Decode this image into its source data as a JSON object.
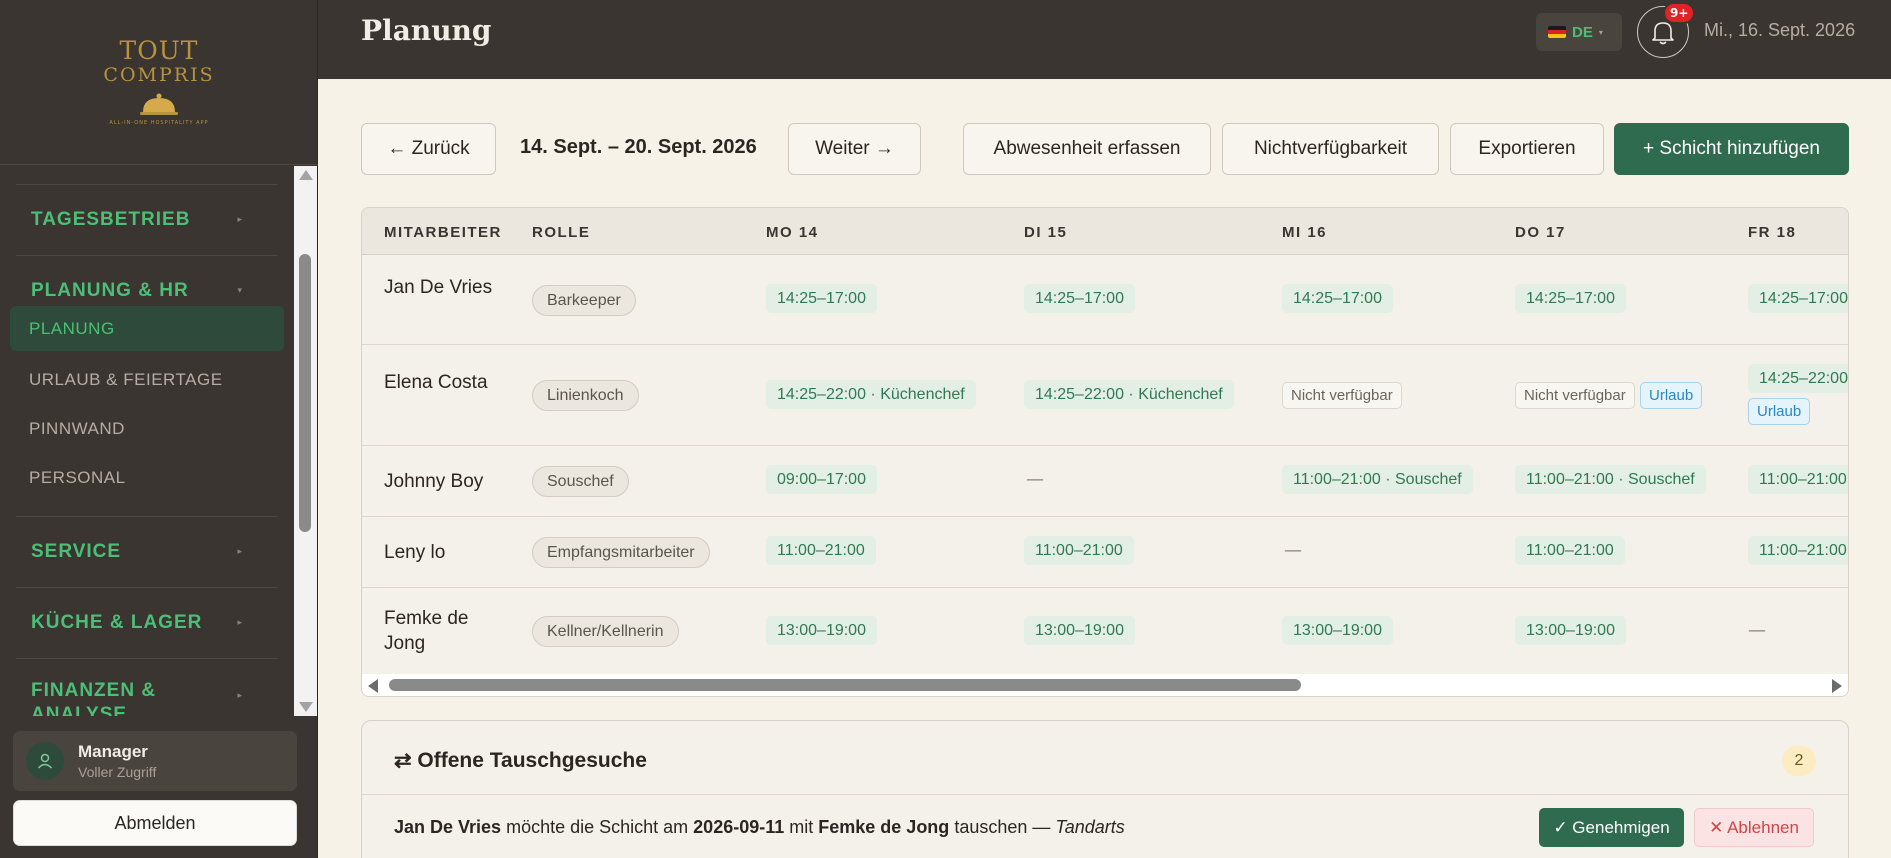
{
  "brand": {
    "line1": "TOUT",
    "line2": "COMPRIS",
    "tagline": "ALL-IN-ONE HOSPITALITY APP",
    "color": "#b8933e"
  },
  "sidebar": {
    "groups": [
      {
        "label": "TAGESBETRIEB",
        "expanded": false
      },
      {
        "label": "PLANUNG & HR",
        "expanded": true
      },
      {
        "label": "SERVICE",
        "expanded": false
      },
      {
        "label": "KÜCHE & LAGER",
        "expanded": false
      },
      {
        "label": "FINANZEN & ANALYSE",
        "expanded": false
      }
    ],
    "items": [
      {
        "label": "PLANUNG",
        "active": true
      },
      {
        "label": "URLAUB & FEIERTAGE",
        "active": false
      },
      {
        "label": "PINNWAND",
        "active": false
      },
      {
        "label": "PERSONAL",
        "active": false
      }
    ],
    "user": {
      "name": "Manager",
      "role": "Voller Zugriff"
    },
    "logout_label": "Abmelden"
  },
  "topbar": {
    "title": "Planung",
    "language": "DE",
    "notification_badge": "9+",
    "date": "Mi., 16. Sept. 2026"
  },
  "toolbar": {
    "back_label": "← Zurück",
    "week_range": "14. Sept. – 20. Sept. 2026",
    "next_label": "Weiter →",
    "absence_label": "Abwesenheit erfassen",
    "unavailability_label": "Nichtverfügbarkeit",
    "export_label": "Exportieren",
    "add_shift_label": "+ Schicht hinzufügen"
  },
  "schedule": {
    "headers": [
      "MITARBEITER",
      "ROLLE",
      "MO 14",
      "DI 15",
      "MI 16",
      "DO 17",
      "FR 18"
    ],
    "rows": [
      {
        "employee": "Jan De Vries",
        "role": "Barkeeper",
        "days": [
          {
            "shift": "14:25–17:00"
          },
          {
            "shift": "14:25–17:00"
          },
          {
            "shift": "14:25–17:00"
          },
          {
            "shift": "14:25–17:00"
          },
          {
            "shift": "14:25–17:00"
          }
        ]
      },
      {
        "employee": "Elena Costa",
        "role": "Linienkoch",
        "days": [
          {
            "shift": "14:25–22:00 · Küchenchef"
          },
          {
            "shift": "14:25–22:00 · Küchenchef"
          },
          {
            "unavailable": "Nicht verfügbar"
          },
          {
            "unavailable": "Nicht verfügbar",
            "leave": "Urlaub"
          },
          {
            "shift": "14:25–22:00",
            "leave": "Urlaub"
          }
        ]
      },
      {
        "employee": "Johnny Boy",
        "role": "Souschef",
        "days": [
          {
            "shift": "09:00–17:00"
          },
          {
            "dash": "—"
          },
          {
            "shift": "11:00–21:00 · Souschef"
          },
          {
            "shift": "11:00–21:00 · Souschef"
          },
          {
            "shift": "11:00–21:00"
          }
        ]
      },
      {
        "employee": "Leny lo",
        "role": "Empfangsmitarbeiter",
        "days": [
          {
            "shift": "11:00–21:00"
          },
          {
            "shift": "11:00–21:00"
          },
          {
            "dash": "—"
          },
          {
            "shift": "11:00–21:00"
          },
          {
            "shift": "11:00–21:00"
          }
        ]
      },
      {
        "employee": "Femke de Jong",
        "role": "Kellner/Kellnerin",
        "days": [
          {
            "shift": "13:00–19:00"
          },
          {
            "shift": "13:00–19:00"
          },
          {
            "shift": "13:00–19:00"
          },
          {
            "shift": "13:00–19:00"
          },
          {
            "dash": "—"
          }
        ]
      }
    ]
  },
  "swaps": {
    "title": "⇄ Offene Tauschgesuche",
    "count": "2",
    "request": {
      "from": "Jan De Vries",
      "text1": " möchte die Schicht am ",
      "date": "2026-09-11",
      "text2": " mit ",
      "to": "Femke de Jong",
      "text3": " tauschen — ",
      "reason": "Tandarts"
    },
    "approve_label": "✓ Genehmigen",
    "reject_label": "✕ Ablehnen"
  },
  "colors": {
    "accent_green": "#2f6b4f",
    "nav_green": "#4cbf77",
    "sidebar_bg": "#3a3530",
    "content_bg": "#f6f2e8"
  }
}
